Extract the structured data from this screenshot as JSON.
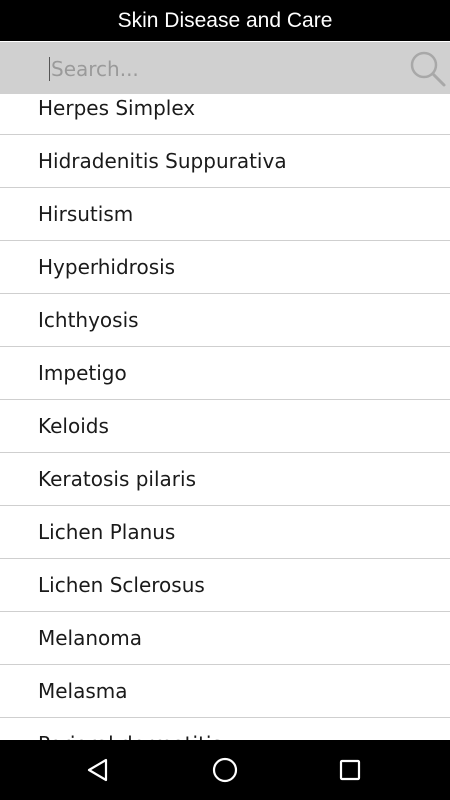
{
  "app": {
    "title": "Skin Disease and Care"
  },
  "search": {
    "placeholder": "Search...",
    "value": "",
    "icon": "search-icon"
  },
  "list": {
    "items": [
      "Herpes Simplex",
      "Hidradenitis Suppurativa",
      "Hirsutism",
      "Hyperhidrosis",
      "Ichthyosis",
      "Impetigo",
      "Keloids",
      "Keratosis pilaris",
      "Lichen Planus",
      "Lichen Sclerosus",
      "Melanoma",
      "Melasma",
      "Perioral dermatitis"
    ]
  },
  "navbar": {
    "back": "back-icon",
    "home": "home-icon",
    "recents": "recents-icon"
  },
  "colors": {
    "titlebar": "#000000",
    "searchbar": "#d0d0d0",
    "divider": "#cfcfcf",
    "navbar": "#000000"
  }
}
